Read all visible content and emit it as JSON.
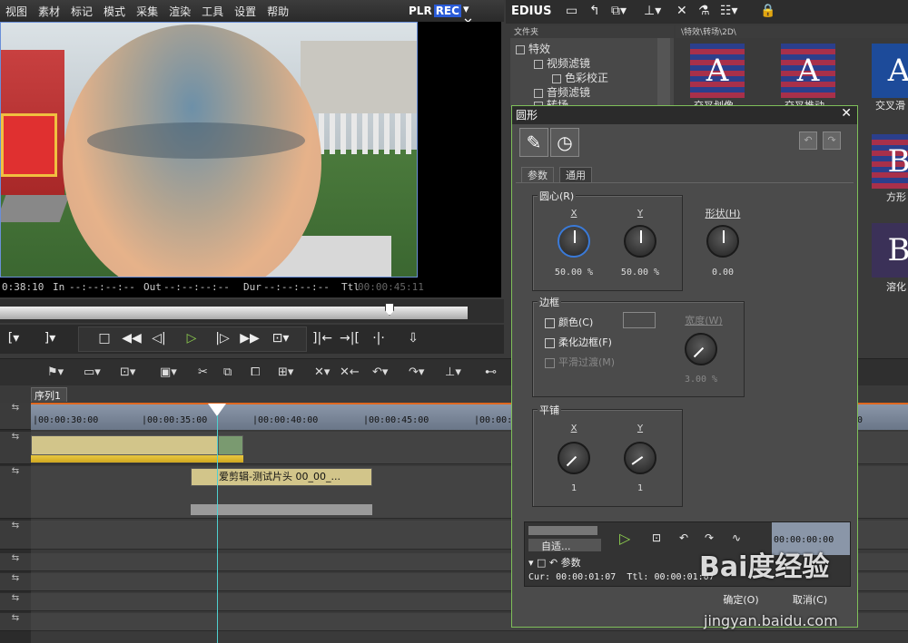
{
  "menu": [
    "视图",
    "素材",
    "标记",
    "模式",
    "采集",
    "渲染",
    "工具",
    "设置",
    "帮助"
  ],
  "plr": "PLR",
  "rec": "REC",
  "window_buttons": "▾ ✕",
  "preview_timecodes": {
    "current": "0:38:10",
    "in_label": "In",
    "in_value": "--:--:--:--",
    "out_label": "Out",
    "out_value": "--:--:--:--",
    "dur_label": "Dur",
    "dur_value": "--:--:--:--",
    "ttl_label": "Ttl",
    "ttl_value": "00:00:45:11"
  },
  "library": {
    "app_name": "EDIUS",
    "tree_header": "文件夹",
    "tree_items": [
      "特效",
      "视频滤镜",
      "色彩校正",
      "音频滤镜",
      "转场"
    ],
    "grid_header": "\\特效\\转场\\2D\\",
    "grid_items": [
      "交叉划像",
      "交叉推动",
      "交叉滑",
      "方形",
      "溶化"
    ]
  },
  "timeline": {
    "sequence_tab": "序列1",
    "ruler_labels": [
      "|00:00:30:00",
      "|00:00:35:00",
      "|00:00:40:00",
      "|00:00:45:00",
      "|00:00:5"
    ],
    "clip_label": "爱剪辑-测试片头 00_00_..."
  },
  "dialog": {
    "title": "圆形",
    "tabs": [
      "参数",
      "通用"
    ],
    "center_group": "圆心(R)",
    "center_x_label": "X",
    "center_y_label": "Y",
    "center_x_value": "50.00 %",
    "center_y_value": "50.00 %",
    "shape_label": "形状(H)",
    "shape_value": "0.00",
    "border_group": "边框",
    "color_label": "颜色(C)",
    "soft_border_label": "柔化边框(F)",
    "smooth_label": "平滑过渡(M)",
    "width_label": "宽度(W)",
    "width_value": "3.00 %",
    "tile_group": "平铺",
    "tile_x_label": "X",
    "tile_y_label": "Y",
    "tile_x_value": "1",
    "tile_y_value": "1",
    "fit_label": "自适...",
    "param_label": "参数",
    "mini_ruler": "00:00:00:00",
    "cur_label": "Cur: 00:00:01:07",
    "ttl_label": "Ttl: 00:00:01:07",
    "ok": "确定(O)",
    "cancel": "取消(C)"
  },
  "watermark": "Bai度经验",
  "watermark_url": "jingyan.baidu.com",
  "colors": {
    "accent_green": "#8fd14f",
    "playhead": "#4fd0d0",
    "ruler_orange": "#e06820"
  }
}
